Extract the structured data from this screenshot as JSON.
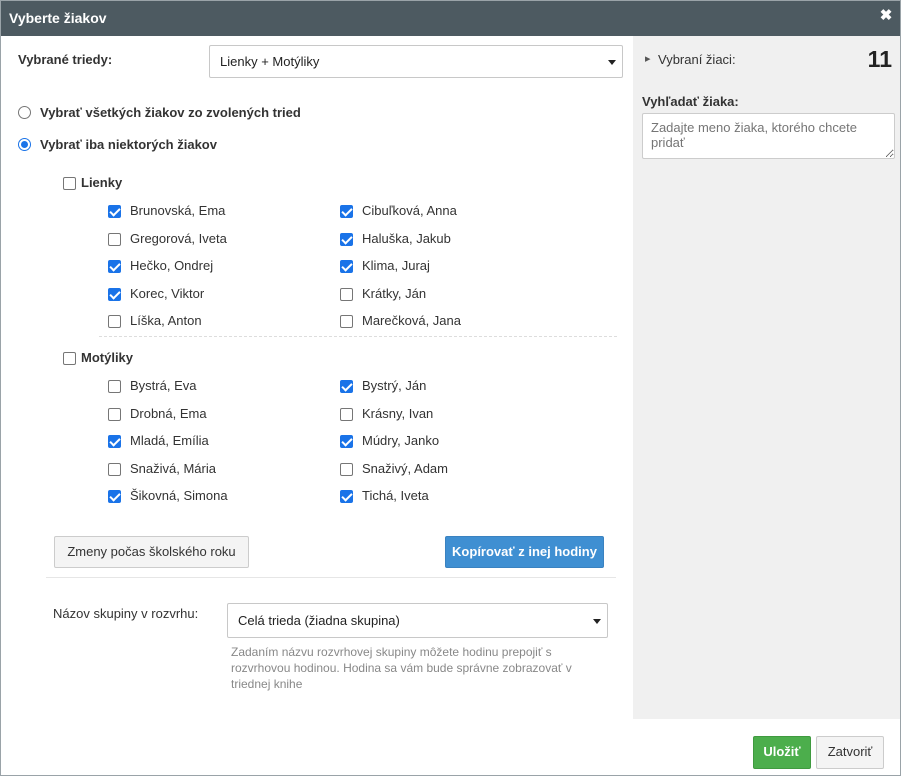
{
  "dialog": {
    "title": "Vyberte žiakov",
    "close_glyph": "✖"
  },
  "classes": {
    "label": "Vybrané triedy:",
    "selected": "Lienky + Motýliky"
  },
  "mode": {
    "all_label": "Vybrať všetkých žiakov zo zvolených tried",
    "some_label": "Vybrať iba niektorých žiakov",
    "selected": "some"
  },
  "groups": [
    {
      "name": "Lienky",
      "checked": false,
      "students": [
        {
          "name": "Brunovská, Ema",
          "checked": true
        },
        {
          "name": "Cibuľková, Anna",
          "checked": true
        },
        {
          "name": "Gregorová, Iveta",
          "checked": false
        },
        {
          "name": "Haluška, Jakub",
          "checked": true
        },
        {
          "name": "Hečko, Ondrej",
          "checked": true
        },
        {
          "name": "Klima, Juraj",
          "checked": true
        },
        {
          "name": "Korec, Viktor",
          "checked": true
        },
        {
          "name": "Krátky, Ján",
          "checked": false
        },
        {
          "name": "Líška, Anton",
          "checked": false
        },
        {
          "name": "Marečková, Jana",
          "checked": false
        }
      ]
    },
    {
      "name": "Motýliky",
      "checked": false,
      "students": [
        {
          "name": "Bystrá, Eva",
          "checked": false
        },
        {
          "name": "Bystrý, Ján",
          "checked": true
        },
        {
          "name": "Drobná, Ema",
          "checked": false
        },
        {
          "name": "Krásny, Ivan",
          "checked": false
        },
        {
          "name": "Mladá, Emília",
          "checked": true
        },
        {
          "name": "Múdry, Janko",
          "checked": true
        },
        {
          "name": "Snaživá, Mária",
          "checked": false
        },
        {
          "name": "Snaživý, Adam",
          "checked": false
        },
        {
          "name": "Šikovná, Simona",
          "checked": true
        },
        {
          "name": "Tichá, Iveta",
          "checked": true
        }
      ]
    }
  ],
  "buttons": {
    "changes": "Zmeny počas školského roku",
    "copy": "Kopírovať z inej hodiny",
    "save": "Uložiť",
    "close": "Zatvoriť"
  },
  "group_name": {
    "label": "Názov skupiny v rozvrhu:",
    "selected": "Celá trieda (žiadna skupina)",
    "help": "Zadaním názvu rozvrhovej skupiny môžete hodinu prepojiť s rozvrhovou hodinou. Hodina sa vám bude správne zobrazovať v triednej knihe"
  },
  "sidebar": {
    "selected_label": "Vybraní žiaci:",
    "selected_count": "11",
    "search_label": "Vyhľadať žiaka:",
    "search_placeholder": "Zadajte meno žiaka, ktorého chcete pridať",
    "expand_glyph": "▸"
  },
  "colors": {
    "titlebar": "#4d5a61",
    "accent_blue": "#1a73e8",
    "primary_button": "#3f8fd2",
    "success_button": "#4cae4c",
    "sidebar_bg": "#f0f0f0"
  }
}
